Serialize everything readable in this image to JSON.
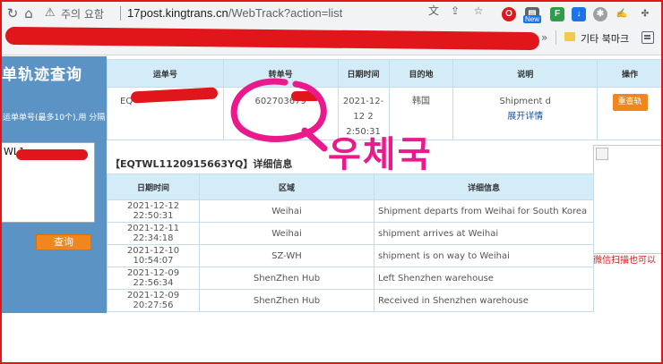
{
  "browser": {
    "security_warning": "주의 요함",
    "url_host": "17post.kingtrans.cn",
    "url_path": "/WebTrack?action=list",
    "ext_new_badge": "New",
    "bookmark_folder": "기타 북마크",
    "bookmarks_more": "»"
  },
  "left": {
    "title": "单轨迹查询",
    "hint": "运单单号(最多10个),用 分隔",
    "textarea_value": "WL1",
    "query_button": "查询"
  },
  "main_table": {
    "headers": [
      "运单号",
      "转单号",
      "日期时间",
      "目的地",
      "说明",
      "操作"
    ],
    "row": {
      "waybill": "EQ",
      "transfer_no": "602703679",
      "datetime_line1": "2021-12-12 2",
      "datetime_line2": "2:50:31",
      "destination": "韩国",
      "description": "Shipment d",
      "expand_link": "展开详情",
      "action_button": "重查轨"
    }
  },
  "detail": {
    "title": "【EQTWL1120915663YQ】详细信息",
    "headers": [
      "日期时间",
      "区域",
      "详细信息"
    ],
    "rows": [
      {
        "time": "2021-12-12 22:50:31",
        "area": "Weihai",
        "info": "Shipment departs from Weihai for South Korea"
      },
      {
        "time": "2021-12-11 22:34:18",
        "area": "Weihai",
        "info": "shipment arrives at Weihai"
      },
      {
        "time": "2021-12-10 10:54:07",
        "area": "SZ-WH",
        "info": "shipment is on way to Weihai"
      },
      {
        "time": "2021-12-09 22:56:34",
        "area": "ShenZhen Hub",
        "info": "Left Shenzhen warehouse"
      },
      {
        "time": "2021-12-09 20:27:56",
        "area": "ShenZhen Hub",
        "info": "Received in Shenzhen warehouse"
      }
    ]
  },
  "qr": {
    "caption": "微信扫描也可以"
  },
  "annotation": {
    "handwritten_text": "우체국"
  },
  "colors": {
    "header_blue": "#d4ebf8",
    "panel_blue": "#5b93c4",
    "orange": "#f0871e",
    "redaction_red": "#e0161a",
    "marker_pink": "#ea1a8c"
  }
}
